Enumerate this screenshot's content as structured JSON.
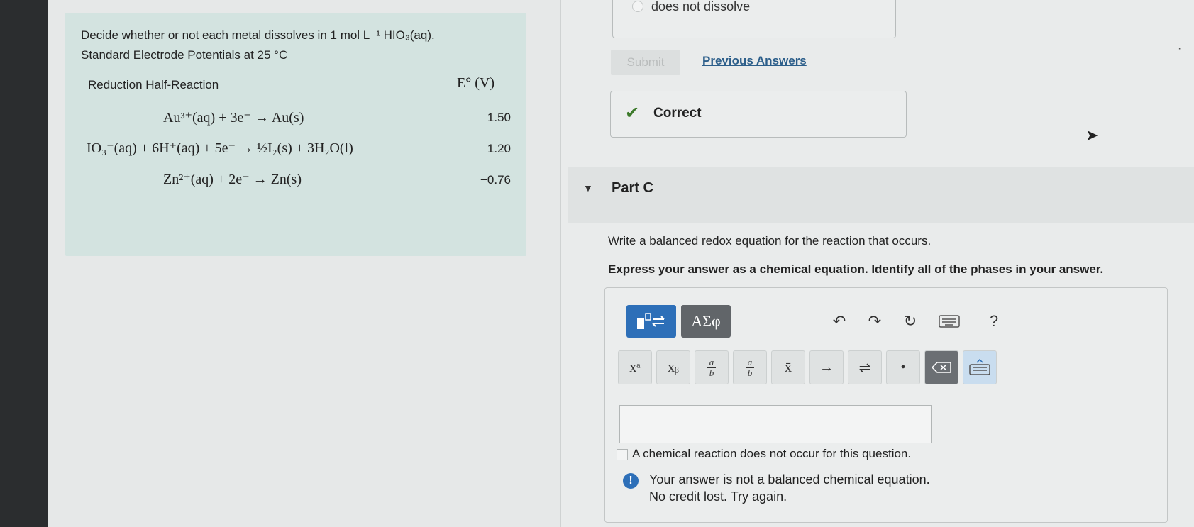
{
  "problem": {
    "intro": "Decide whether or not each metal dissolves in 1 mol L⁻¹ HIO₃(aq).",
    "subtitle": "Standard Electrode Potentials at 25 °C",
    "col_reaction": "Reduction Half-Reaction",
    "col_potential": "E° (V)",
    "rows": [
      {
        "reaction": "Au³⁺(aq) + 3e⁻ → Au(s)",
        "potential": "1.50"
      },
      {
        "reaction": "IO₃⁻(aq) + 6H⁺(aq) + 5e⁻ → ½I₂(s) + 3H₂O(l)",
        "potential": "1.20"
      },
      {
        "reaction": "Zn²⁺(aq) + 2e⁻ → Zn(s)",
        "potential": "−0.76"
      }
    ]
  },
  "part_b": {
    "option_label": "does not dissolve",
    "submit_label": "Submit",
    "previous_answers_label": "Previous Answers",
    "correct_label": "Correct"
  },
  "part_c": {
    "title": "Part C",
    "instruction_1": "Write a balanced redox equation for the reaction that occurs.",
    "instruction_2": "Express your answer as a chemical equation. Identify all of the phases in your answer.",
    "toolbar": {
      "greek_label": "ΑΣφ",
      "help_label": "?"
    },
    "symbols": {
      "superscript": "xᵃ",
      "subscript": "xᵦ",
      "overline": "x̄",
      "arrow": "→",
      "equilibrium": "⇌",
      "dot": "•"
    },
    "answer_value": "",
    "no_reaction_label": "A chemical reaction does not occur for this question.",
    "feedback_line_1": "Your answer is not a balanced chemical equation.",
    "feedback_line_2": "No credit lost. Try again."
  }
}
